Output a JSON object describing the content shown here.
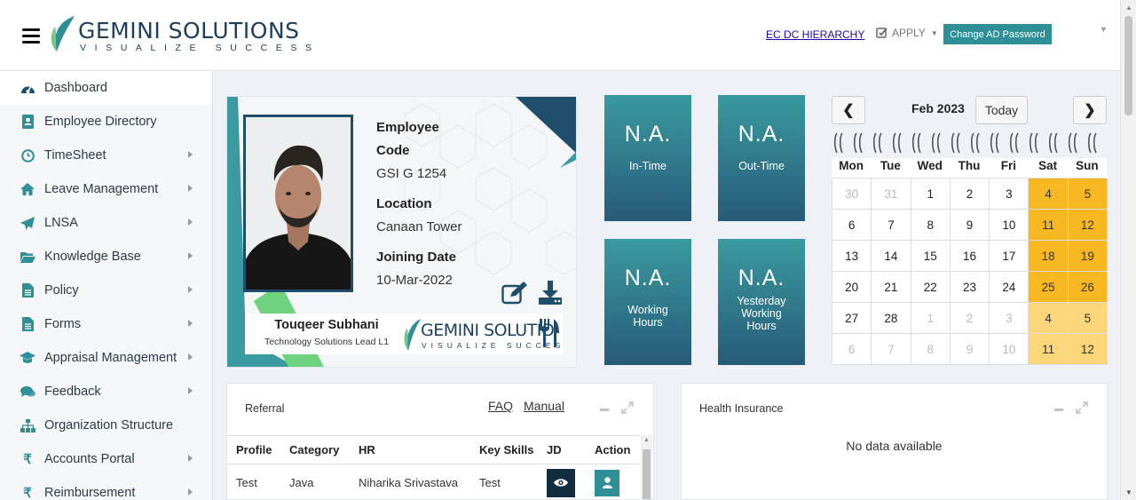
{
  "header": {
    "logo_title": "GEMINI SOLUTIONS",
    "logo_tagline": "VISUALIZE SUCCESS",
    "hierarchy_link": "EC DC HIERARCHY",
    "apply_label": "APPLY",
    "change_password_label": "Change AD Password"
  },
  "sidebar": {
    "items": [
      {
        "label": "Dashboard",
        "icon": "dashboard-icon"
      },
      {
        "label": "Employee Directory",
        "icon": "directory-icon"
      },
      {
        "label": "TimeSheet",
        "icon": "clock-icon"
      },
      {
        "label": "Leave Management",
        "icon": "home-icon"
      },
      {
        "label": "LNSA",
        "icon": "paper-plane-icon"
      },
      {
        "label": "Knowledge Base",
        "icon": "folder-icon"
      },
      {
        "label": "Policy",
        "icon": "document-icon"
      },
      {
        "label": "Forms",
        "icon": "document-icon"
      },
      {
        "label": "Appraisal Management",
        "icon": "graduation-cap-icon"
      },
      {
        "label": "Feedback",
        "icon": "comments-icon"
      },
      {
        "label": "Organization Structure",
        "icon": "sitemap-icon"
      },
      {
        "label": "Accounts Portal",
        "icon": "rupee-icon"
      },
      {
        "label": "Reimbursement",
        "icon": "rupee-icon"
      }
    ]
  },
  "profile": {
    "code_label_line1": "Employee",
    "code_label_line2": "Code",
    "code_value": "GSI G 1254",
    "location_label": "Location",
    "location_value": "Canaan Tower",
    "joining_label": "Joining Date",
    "joining_value": "10-Mar-2022",
    "name": "Touqeer Subhani",
    "role": "Technology Solutions Lead L1",
    "card_logo_title": "GEMINI SOLUTIO",
    "card_logo_tagline": "VISUALIZE SUCCESS"
  },
  "tiles": [
    {
      "value": "N.A.",
      "label": "In-Time"
    },
    {
      "value": "N.A.",
      "label": "Out-Time"
    },
    {
      "value": "N.A.",
      "label": "Working Hours"
    },
    {
      "value": "N.A.",
      "label": "Yesterday Working Hours"
    }
  ],
  "calendar": {
    "prev_label": "❮",
    "next_label": "❯",
    "month": "Feb 2023",
    "today_label": "Today",
    "weekdays": [
      "Mon",
      "Tue",
      "Wed",
      "Thu",
      "Fri",
      "Sat",
      "Sun"
    ],
    "weeks": [
      [
        "30",
        "31",
        "1",
        "2",
        "3",
        "4",
        "5"
      ],
      [
        "6",
        "7",
        "8",
        "9",
        "10",
        "11",
        "12"
      ],
      [
        "13",
        "14",
        "15",
        "16",
        "17",
        "18",
        "19"
      ],
      [
        "20",
        "21",
        "22",
        "23",
        "24",
        "25",
        "26"
      ],
      [
        "27",
        "28",
        "1",
        "2",
        "3",
        "4",
        "5"
      ],
      [
        "6",
        "7",
        "8",
        "9",
        "10",
        "11",
        "12"
      ]
    ],
    "weekend_color": "#f8b822"
  },
  "referral": {
    "title": "Referral",
    "faq_label": "FAQ",
    "manual_label": "Manual",
    "columns": [
      "Profile",
      "Category",
      "HR",
      "Key Skills",
      "JD",
      "Action"
    ],
    "rows": [
      {
        "profile": "Test",
        "category": "Java",
        "hr": "Niharika Srivastava",
        "skills": "Test"
      }
    ]
  },
  "insurance": {
    "title": "Health Insurance",
    "empty_text": "No data available"
  },
  "colors": {
    "accent": "#2e8f97",
    "navy": "#1f4e6c"
  }
}
